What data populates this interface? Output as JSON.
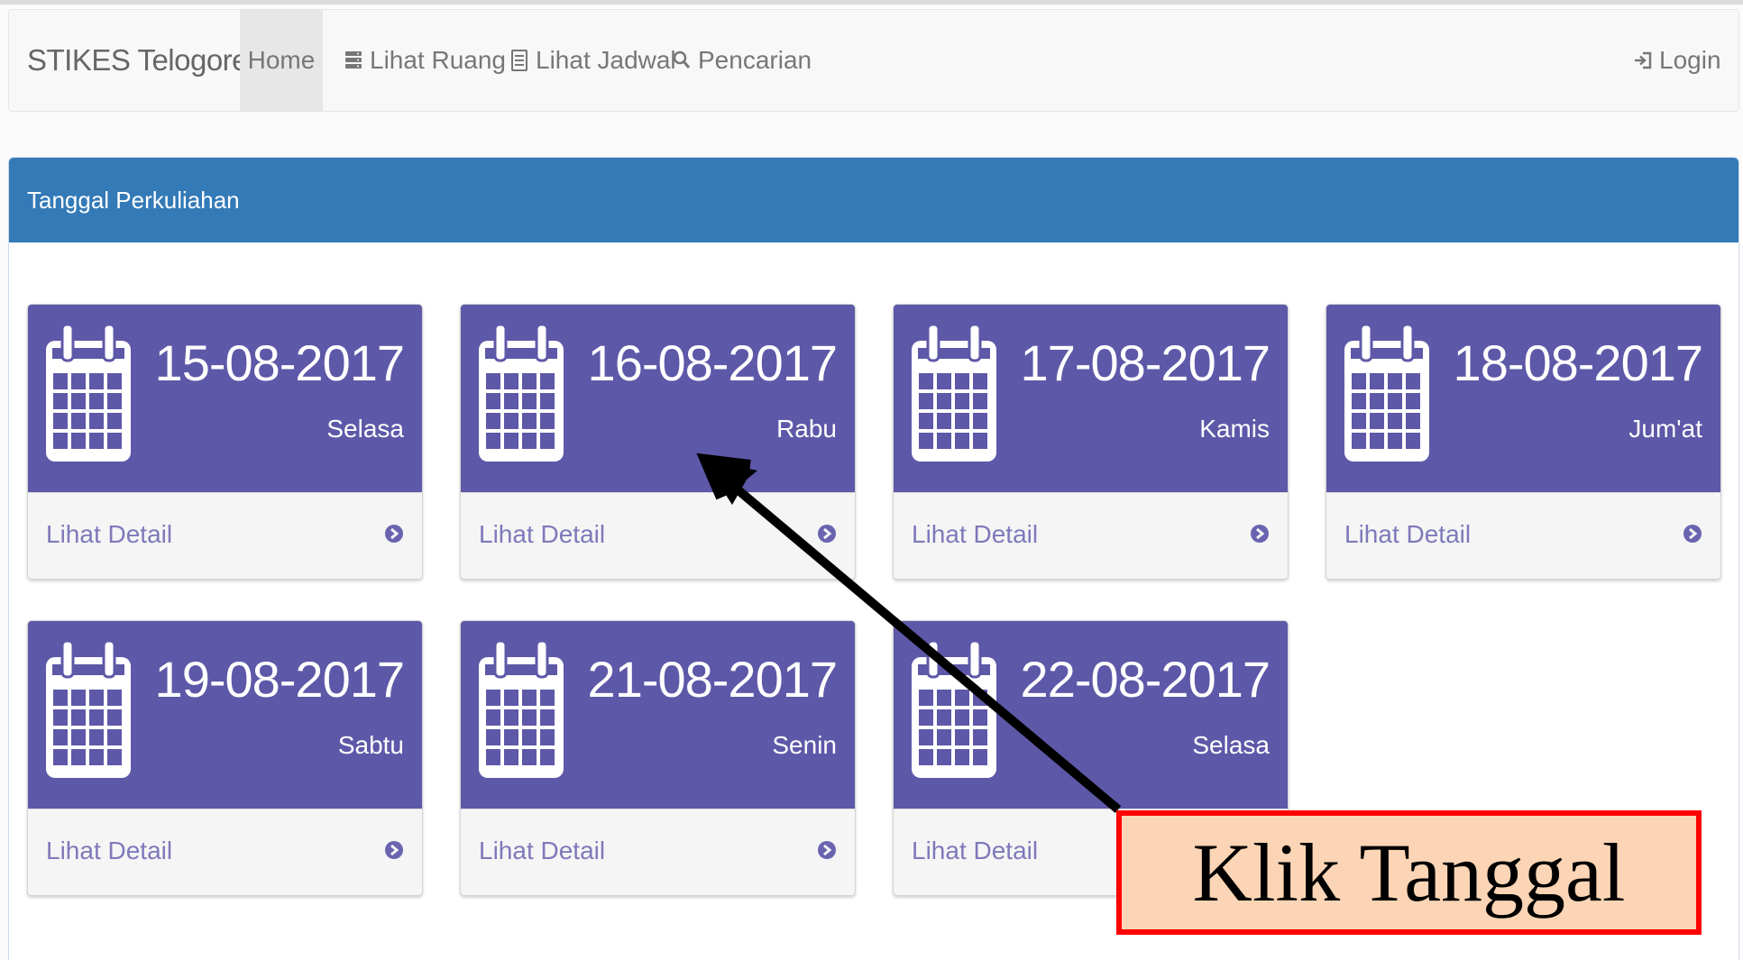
{
  "navbar": {
    "brand": "STIKES Telogorejo",
    "items": [
      {
        "label": "Home",
        "icon": "",
        "active": true
      },
      {
        "label": "Lihat Ruang",
        "icon": "server-icon"
      },
      {
        "label": "Lihat Jadwal",
        "icon": "list-alt-icon"
      },
      {
        "label": "Pencarian",
        "icon": "search-icon"
      }
    ],
    "login": {
      "label": "Login",
      "icon": "log-in-icon"
    }
  },
  "panel": {
    "heading": "Tanggal Perkuliahan",
    "cards": [
      {
        "date": "15-08-2017",
        "day": "Selasa",
        "detail": "Lihat Detail"
      },
      {
        "date": "16-08-2017",
        "day": "Rabu",
        "detail": "Lihat Detail"
      },
      {
        "date": "17-08-2017",
        "day": "Kamis",
        "detail": "Lihat Detail"
      },
      {
        "date": "18-08-2017",
        "day": "Jum'at",
        "detail": "Lihat Detail"
      },
      {
        "date": "19-08-2017",
        "day": "Sabtu",
        "detail": "Lihat Detail"
      },
      {
        "date": "21-08-2017",
        "day": "Senin",
        "detail": "Lihat Detail"
      },
      {
        "date": "22-08-2017",
        "day": "Selasa",
        "detail": "Lihat Detail"
      }
    ]
  },
  "annotation": {
    "text": "Klik Tanggal"
  },
  "colors": {
    "heading": "#337ab7",
    "card": "#5e58a8",
    "callout_fill": "#fbd5b5",
    "callout_border": "#ff0000"
  }
}
